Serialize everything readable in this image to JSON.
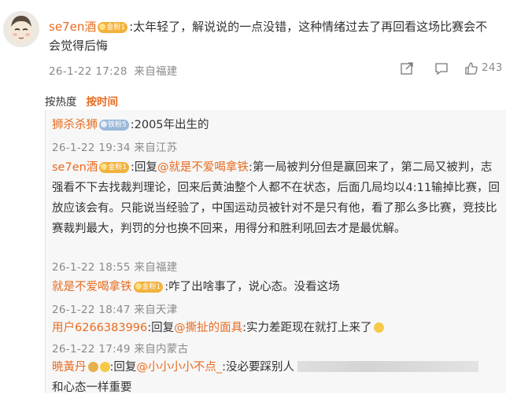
{
  "comment": {
    "username": "se7en酒",
    "badge": "金粉1",
    "text": ":太年轻了，解说说的一点没错，这种情绪过去了再回看这场比赛会不会觉得后悔",
    "time": "26-1-22 17:28",
    "location": "来自福建",
    "like_count": "243"
  },
  "sort": {
    "hot_label": "按热度",
    "time_label": "按时间"
  },
  "replies": [
    {
      "username": "狮杀杀狮",
      "badge": "铁粉5",
      "badge_type": "iron",
      "reply_prefix": "",
      "mention": "",
      "text": ":2005年出生的",
      "time": "26-1-22 19:34",
      "location": "来自江苏"
    },
    {
      "username": "se7en酒",
      "badge": "金粉1",
      "badge_type": "gold",
      "reply_prefix": ":回复",
      "mention": "@就是不爱喝拿铁",
      "text": ":第一局被判分但是赢回来了，第二局又被判，志强看不下去找裁判理论，回来后黄油整个人都不在状态，后面几局均以4:11输掉比赛，回放应该会有。只能说当经验了，中国运动员被针对不是只有他，看了那么多比赛，竞技比赛裁判最大，判罚的分也换不回来，用得分和胜利吼回去才是最优解。",
      "time": "26-1-22 18:55",
      "location": "来自福建"
    },
    {
      "username": "就是不爱喝拿铁",
      "badge": "金粉1",
      "badge_type": "gold",
      "reply_prefix": "",
      "mention": "",
      "text": ":咋了出啥事了，说心态。没看这场",
      "time": "26-1-22 18:47",
      "location": "来自天津"
    },
    {
      "username": "用户6266383996",
      "badge": "",
      "badge_type": "iron",
      "reply_prefix": ":回复",
      "mention": "@撕扯的面具",
      "text": ":实力差距现在就打上来了",
      "time": "26-1-22 17:49",
      "location": "来自内蒙古"
    },
    {
      "username": "暁黃丹",
      "badge": "",
      "badge_type": "gold",
      "reply_prefix": ":回复",
      "mention": "@小小小小不点_",
      "text": ":没必要踩别人",
      "text_line2": "和心态一样重要",
      "time": "",
      "location": ""
    }
  ]
}
